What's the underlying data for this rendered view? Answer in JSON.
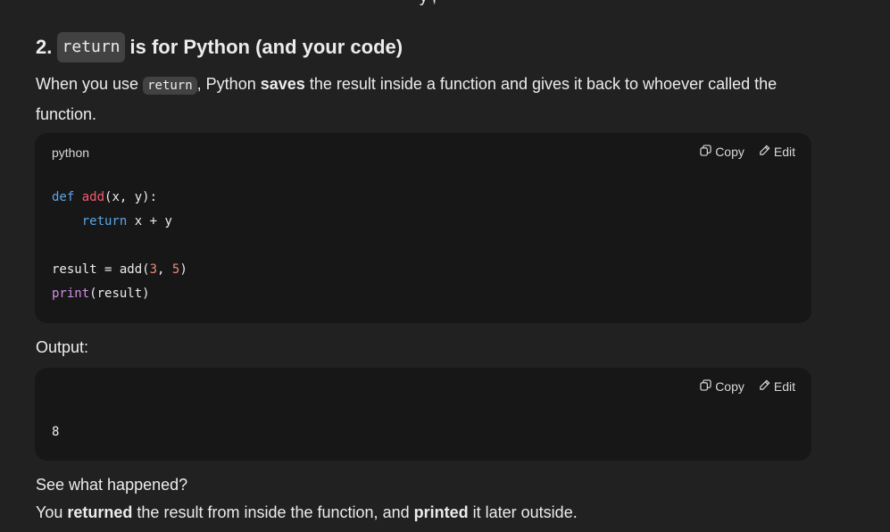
{
  "top_fragment": "y     ,",
  "heading": {
    "number": "2.",
    "code": "return",
    "rest": "is for Python (and your code)"
  },
  "intro": {
    "part1": "When you use",
    "code": "return",
    "part2": ", Python",
    "bold": "saves",
    "part3": "the result inside a function and gives it back to whoever called the function."
  },
  "code_block_1": {
    "language": "python",
    "copy_label": "Copy",
    "edit_label": "Edit",
    "lines": {
      "l1_kw": "def",
      "l1_fn": "add",
      "l1_rest": "(x, y):",
      "l2_kw": "return",
      "l2_rest": " x + y",
      "l4_a": "result = add(",
      "l4_n1": "3",
      "l4_b": ", ",
      "l4_n2": "5",
      "l4_c": ")",
      "l5_bi": "print",
      "l5_rest": "(result)"
    }
  },
  "output_label": "Output:",
  "code_block_2": {
    "copy_label": "Copy",
    "edit_label": "Edit",
    "output": "8"
  },
  "see_what": "See what happened?",
  "summary": {
    "part1": "You",
    "bold1": "returned",
    "part2": "the result from inside the function, and",
    "bold2": "printed",
    "part3": "it later outside."
  },
  "icons": {
    "copy": "copy-icon",
    "edit": "edit-icon"
  },
  "colors": {
    "background": "#212121",
    "code_background": "#171717",
    "keyword": "#5ca6e6",
    "function_name": "#f25b6b",
    "number": "#e88c7a",
    "builtin": "#d18fe3"
  }
}
